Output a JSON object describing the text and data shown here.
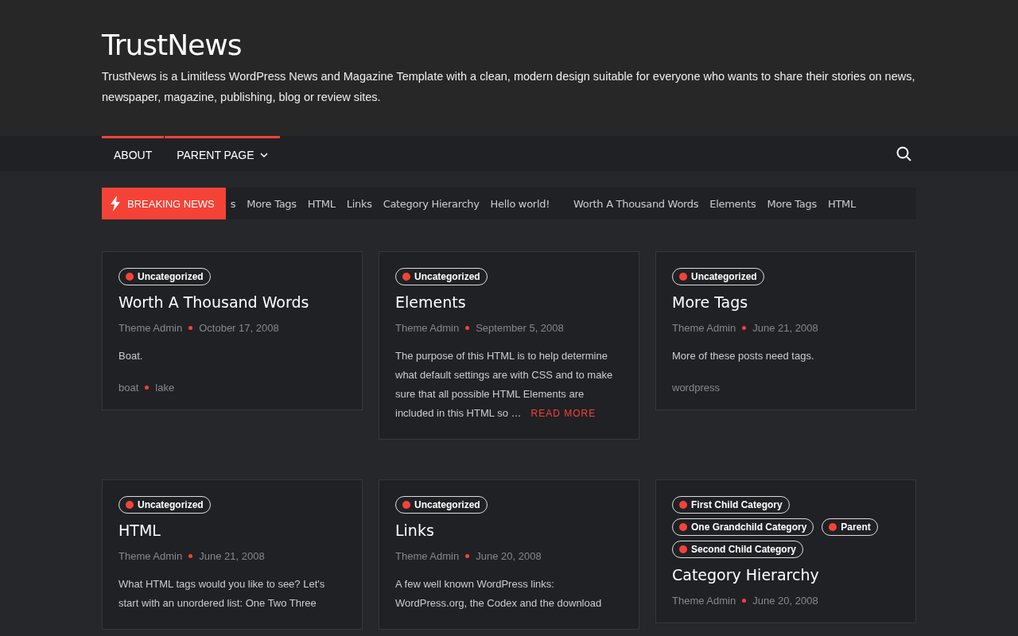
{
  "site": {
    "title": "TrustNews",
    "tagline": "TrustNews is a Limitless WordPress News and Magazine Template with a clean, modern design suitable for everyone who wants to share their stories on news, newspaper, magazine, publishing, blog or review sites."
  },
  "nav": {
    "items": [
      {
        "label": "ABOUT",
        "has_submenu": false
      },
      {
        "label": "PARENT PAGE",
        "has_submenu": true
      }
    ]
  },
  "breaking": {
    "label": "BREAKING NEWS",
    "items": [
      "s",
      "More Tags",
      "HTML",
      "Links",
      "Category Hierarchy",
      "Hello world!",
      "Worth A Thousand Words",
      "Elements",
      "More Tags",
      "HTML"
    ]
  },
  "posts": [
    {
      "categories": [
        "Uncategorized"
      ],
      "title": "Worth A Thousand Words",
      "author": "Theme Admin",
      "date": "October 17, 2008",
      "excerpt": "Boat.",
      "tags": [
        "boat",
        "lake"
      ]
    },
    {
      "categories": [
        "Uncategorized"
      ],
      "title": "Elements",
      "author": "Theme Admin",
      "date": "September 5, 2008",
      "excerpt": "The purpose of this HTML is to help determine what default settings are with CSS and to make sure that all possible HTML Elements are included in this HTML so …",
      "read_more": "READ MORE"
    },
    {
      "categories": [
        "Uncategorized"
      ],
      "title": "More Tags",
      "author": "Theme Admin",
      "date": "June 21, 2008",
      "excerpt": "More of these posts need tags.",
      "tags": [
        "wordpress"
      ]
    },
    {
      "categories": [
        "Uncategorized"
      ],
      "title": "HTML",
      "author": "Theme Admin",
      "date": "June 21, 2008",
      "excerpt": "What HTML tags would you like to see? Let's start with an unordered list: One Two Three"
    },
    {
      "categories": [
        "Uncategorized"
      ],
      "title": "Links",
      "author": "Theme Admin",
      "date": "June 20, 2008",
      "excerpt": "A few well known WordPress links: WordPress.org, the Codex and the download"
    },
    {
      "categories": [
        "First Child Category",
        "One Grandchild Category",
        "Parent",
        "Second Child Category"
      ],
      "title": "Category Hierarchy",
      "author": "Theme Admin",
      "date": "June 20, 2008"
    }
  ]
}
